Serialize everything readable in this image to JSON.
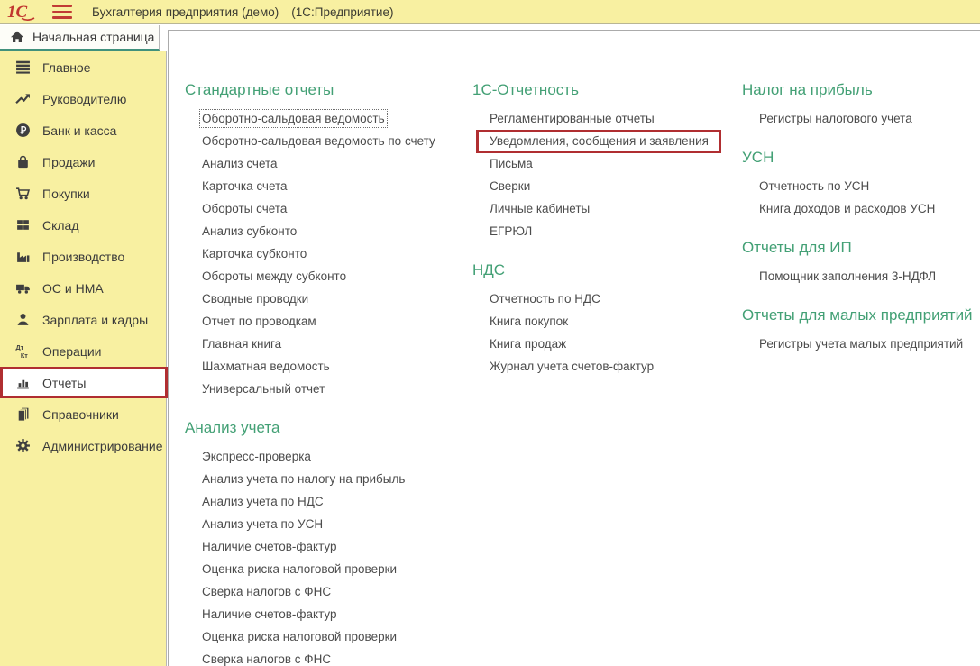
{
  "titlebar": {
    "title": "Бухгалтерия предприятия (демо)",
    "app_label": "(1С:Предприятие)",
    "logo": "1С",
    "menu_icon": "hamburger-icon"
  },
  "tab": {
    "label": "Начальная страница",
    "icon": "home-icon"
  },
  "colors": {
    "accent_green": "#43a075",
    "tab_underline_green": "#41917c",
    "highlight_red": "#b02e31",
    "panel_yellow": "#f8f0a1",
    "link_gray": "#4c4c4c"
  },
  "sidebar": {
    "items": [
      {
        "label": "Главное",
        "icon": "menu-lines-icon",
        "active": false
      },
      {
        "label": "Руководителю",
        "icon": "trend-up-icon",
        "active": false
      },
      {
        "label": "Банк и касса",
        "icon": "ruble-icon",
        "active": false
      },
      {
        "label": "Продажи",
        "icon": "bag-icon",
        "active": false
      },
      {
        "label": "Покупки",
        "icon": "cart-icon",
        "active": false
      },
      {
        "label": "Склад",
        "icon": "grid-icon",
        "active": false
      },
      {
        "label": "Производство",
        "icon": "factory-icon",
        "active": false
      },
      {
        "label": "ОС и НМА",
        "icon": "truck-icon",
        "active": false
      },
      {
        "label": "Зарплата и кадры",
        "icon": "person-icon",
        "active": false
      },
      {
        "label": "Операции",
        "icon": "dtkt-icon",
        "active": false
      },
      {
        "label": "Отчеты",
        "icon": "barchart-icon",
        "active": true
      },
      {
        "label": "Справочники",
        "icon": "books-icon",
        "active": false
      },
      {
        "label": "Администрирование",
        "icon": "gear-icon",
        "active": false
      }
    ]
  },
  "columns": [
    {
      "sections": [
        {
          "title": "Стандартные отчеты",
          "items": [
            {
              "label": "Оборотно-сальдовая ведомость",
              "focused": true
            },
            {
              "label": "Оборотно-сальдовая ведомость по счету"
            },
            {
              "label": "Анализ счета"
            },
            {
              "label": "Карточка счета"
            },
            {
              "label": "Обороты счета"
            },
            {
              "label": "Анализ субконто"
            },
            {
              "label": "Карточка субконто"
            },
            {
              "label": "Обороты между субконто"
            },
            {
              "label": "Сводные проводки"
            },
            {
              "label": "Отчет по проводкам"
            },
            {
              "label": "Главная книга"
            },
            {
              "label": "Шахматная ведомость"
            },
            {
              "label": "Универсальный отчет"
            }
          ]
        },
        {
          "title": "Анализ учета",
          "items": [
            {
              "label": "Экспресс-проверка"
            },
            {
              "label": "Анализ учета по налогу на прибыль"
            },
            {
              "label": "Анализ учета по НДС"
            },
            {
              "label": "Анализ учета по УСН"
            },
            {
              "label": "Наличие счетов-фактур"
            },
            {
              "label": "Оценка риска налоговой проверки"
            },
            {
              "label": "Сверка налогов с ФНС"
            },
            {
              "label": "Наличие счетов-фактур"
            },
            {
              "label": "Оценка риска налоговой проверки"
            },
            {
              "label": "Сверка налогов с ФНС"
            }
          ]
        }
      ]
    },
    {
      "sections": [
        {
          "title": "1С-Отчетность",
          "items": [
            {
              "label": "Регламентированные отчеты"
            },
            {
              "label": "Уведомления, сообщения и заявления",
              "highlighted": true
            },
            {
              "label": "Письма"
            },
            {
              "label": "Сверки"
            },
            {
              "label": "Личные кабинеты"
            },
            {
              "label": "ЕГРЮЛ"
            }
          ]
        },
        {
          "title": "НДС",
          "items": [
            {
              "label": "Отчетность по НДС"
            },
            {
              "label": "Книга покупок"
            },
            {
              "label": "Книга продаж"
            },
            {
              "label": "Журнал учета счетов-фактур"
            }
          ]
        }
      ]
    },
    {
      "sections": [
        {
          "title": "Налог на прибыль",
          "items": [
            {
              "label": "Регистры налогового учета"
            }
          ]
        },
        {
          "title": "УСН",
          "items": [
            {
              "label": "Отчетность по УСН"
            },
            {
              "label": "Книга доходов и расходов УСН"
            }
          ]
        },
        {
          "title": "Отчеты для ИП",
          "items": [
            {
              "label": "Помощник заполнения 3-НДФЛ"
            }
          ]
        },
        {
          "title": "Отчеты для малых предприятий",
          "items": [
            {
              "label": "Регистры учета малых предприятий"
            }
          ]
        }
      ]
    }
  ]
}
